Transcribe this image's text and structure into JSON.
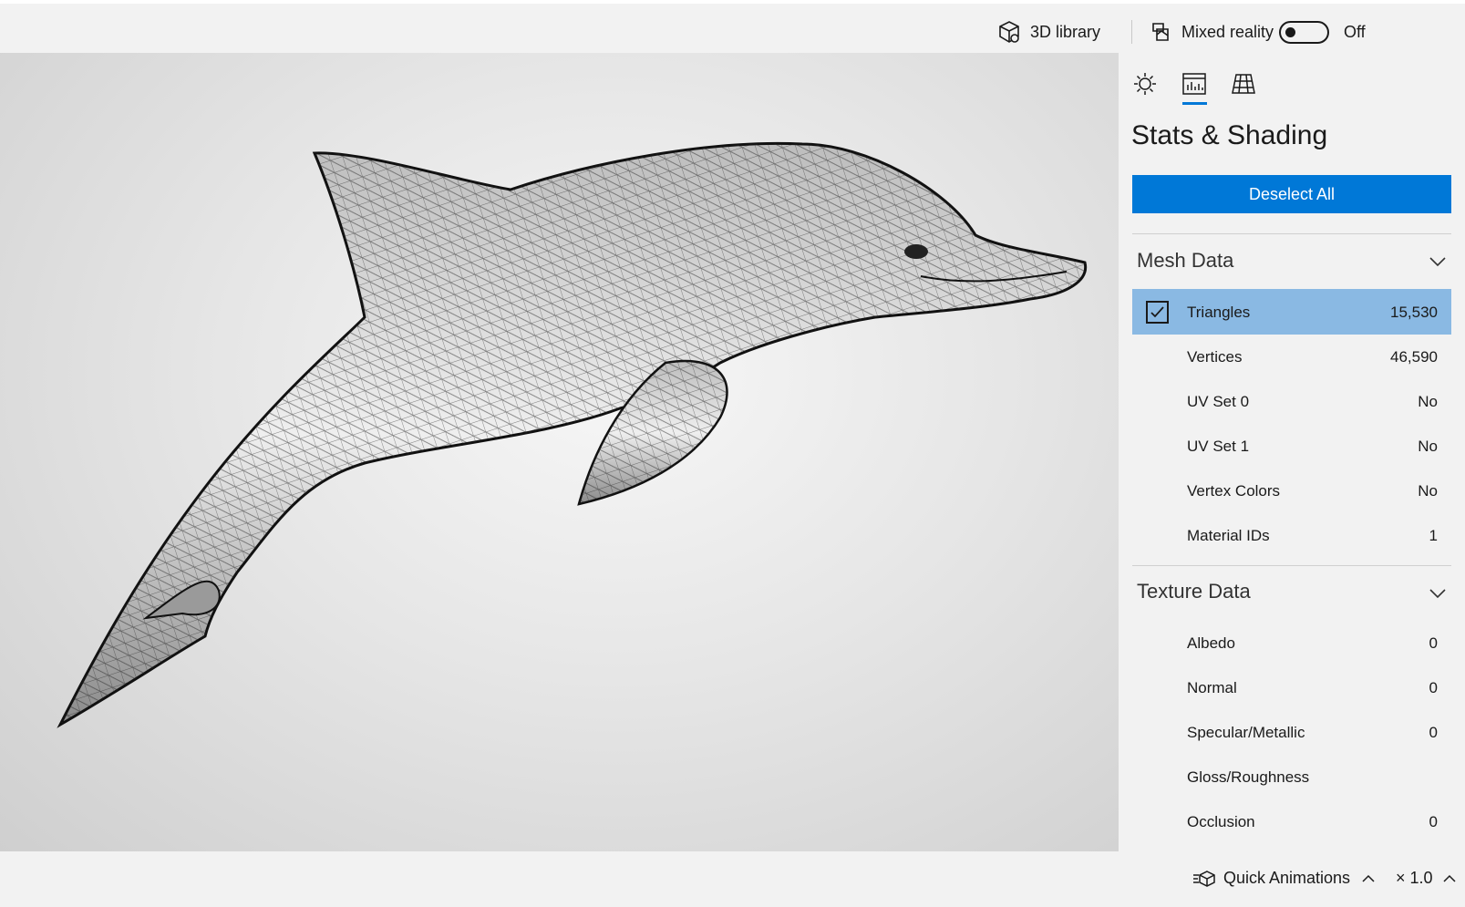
{
  "topbar": {
    "library_label": "3D library",
    "mixed_reality_label": "Mixed reality",
    "toggle_state": "Off"
  },
  "panel": {
    "title": "Stats & Shading",
    "deselect_label": "Deselect All",
    "mesh_section": {
      "title": "Mesh Data",
      "rows": [
        {
          "label": "Triangles",
          "value": "15,530",
          "selected": true
        },
        {
          "label": "Vertices",
          "value": "46,590"
        },
        {
          "label": "UV Set 0",
          "value": "No"
        },
        {
          "label": "UV Set 1",
          "value": "No"
        },
        {
          "label": "Vertex Colors",
          "value": "No"
        },
        {
          "label": "Material IDs",
          "value": "1"
        }
      ]
    },
    "texture_section": {
      "title": "Texture Data",
      "rows": [
        {
          "label": "Albedo",
          "value": "0"
        },
        {
          "label": "Normal",
          "value": "0"
        },
        {
          "label": "Specular/Metallic",
          "value": "0"
        },
        {
          "label": "Gloss/Roughness",
          "value": ""
        },
        {
          "label": "Occlusion",
          "value": "0"
        }
      ]
    }
  },
  "bottombar": {
    "animations_label": "Quick Animations",
    "speed_label": "× 1.0"
  },
  "colors": {
    "accent": "#0078d7",
    "selected_row": "#8ab9e3",
    "panel_bg": "#f2f2f2"
  }
}
